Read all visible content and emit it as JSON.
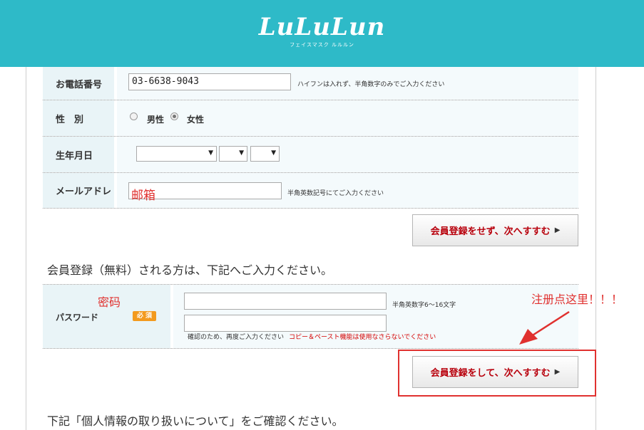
{
  "header": {
    "logo_text": "LuLuLun",
    "logo_sub": "フェイスマスク ルルルン"
  },
  "form": {
    "phone": {
      "label": "お電話番号",
      "value": "03-6638-9043",
      "hint": "ハイフンは入れず、半角数字のみでご入力ください"
    },
    "gender": {
      "label": "性　別",
      "options": [
        "男性",
        "女性"
      ],
      "selected": "女性"
    },
    "birthday": {
      "label": "生年月日"
    },
    "email": {
      "label": "メールアドレ",
      "hint": "半角英数記号にてご入力ください"
    },
    "skip_button": "会員登録をせず、次へすすむ"
  },
  "register": {
    "heading": "会員登録（無料）される方は、下記へご入力ください。",
    "password": {
      "label": "パスワード",
      "required_badge": "必 須",
      "hint": "半角英数字6〜16文字",
      "confirm_note": "確認のため、再度ご入力ください",
      "warning": "コピー＆ペースト機能は使用なさらないでください"
    },
    "register_button": "会員登録をして、次へすすむ"
  },
  "privacy": {
    "heading": "下記「個人情報の取り扱いについて」をご確認ください。"
  },
  "annotations": {
    "email_note": "邮箱",
    "password_note": "密码",
    "click_note": "注册点这里！！！",
    "color": "#e0312f"
  },
  "icons": {
    "button_arrow": "triangle-right-icon",
    "select_arrow": "triangle-down-icon"
  },
  "colors": {
    "header_bg": "#2ebac8",
    "label_bg": "#e9f4f7",
    "button_text": "#b8000c",
    "badge": "#f39a1e"
  }
}
